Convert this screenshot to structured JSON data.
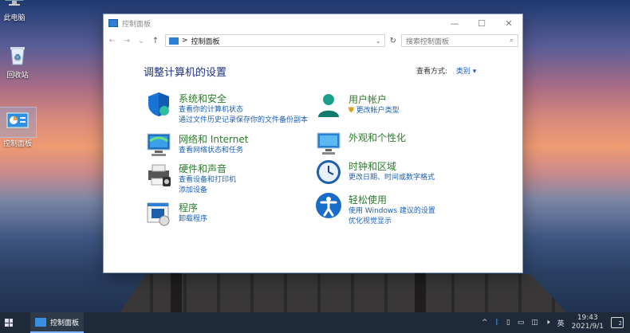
{
  "desktop": {
    "icons": [
      {
        "label": "此电脑",
        "icon": "computer-icon"
      },
      {
        "label": "回收站",
        "icon": "recycle-bin-icon"
      },
      {
        "label": "控制面板",
        "icon": "control-panel-icon"
      }
    ]
  },
  "window": {
    "title": "控制面板",
    "controls": {
      "minimize": "—",
      "maximize": "☐",
      "close": "✕"
    },
    "nav": {
      "back": "←",
      "forward": "→",
      "recent": "⌄",
      "up": "↑"
    },
    "address": {
      "separator": ">",
      "path": "控制面板",
      "dropdown": "⌄",
      "refresh": "↻"
    },
    "search": {
      "placeholder": "搜索控制面板",
      "icon": "⌕"
    },
    "heading": "调整计算机的设置",
    "view_by": {
      "label": "查看方式:",
      "value": "类别 ▾"
    },
    "categories_left": [
      {
        "title": "系统和安全",
        "icon": "shield-icon",
        "links": [
          "查看你的计算机状态",
          "通过文件历史记录保存你的文件备份副本"
        ]
      },
      {
        "title": "网络和 Internet",
        "icon": "network-icon",
        "links": [
          "查看网络状态和任务"
        ]
      },
      {
        "title": "硬件和声音",
        "icon": "printer-icon",
        "links": [
          "查看设备和打印机",
          "添加设备"
        ]
      },
      {
        "title": "程序",
        "icon": "programs-icon",
        "links": [
          "卸载程序"
        ]
      }
    ],
    "categories_right": [
      {
        "title": "用户帐户",
        "icon": "user-icon",
        "links": [
          "更改帐户类型"
        ]
      },
      {
        "title": "外观和个性化",
        "icon": "appearance-icon",
        "links": []
      },
      {
        "title": "时钟和区域",
        "icon": "clock-globe-icon",
        "links": [
          "更改日期、时间或数字格式"
        ]
      },
      {
        "title": "轻松使用",
        "icon": "accessibility-icon",
        "links": [
          "使用 Windows 建议的设置",
          "优化视觉显示"
        ]
      }
    ]
  },
  "taskbar": {
    "app_label": "控制面板",
    "tray": {
      "chevron": "^",
      "ime": "英",
      "notification_count": "2"
    },
    "clock": {
      "time": "19:43",
      "date": "2021/9/1"
    }
  },
  "colors": {
    "accent": "#1a5fb4",
    "category_green": "#2a7d2a",
    "heading_blue": "#1e3287"
  }
}
